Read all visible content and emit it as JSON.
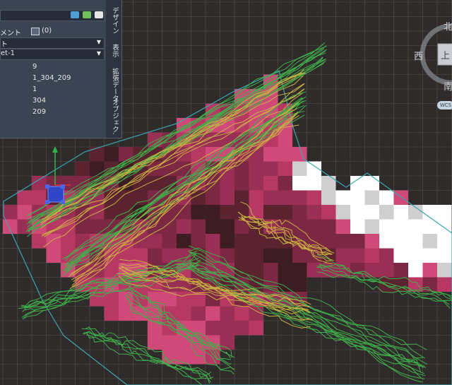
{
  "palette": {
    "comment_label": "メント",
    "comment_count": "(0)",
    "dropdown_1": "",
    "dropdown_2": "ト",
    "dropdown_3": "et-1",
    "values": [
      "9",
      "1_304_209",
      "1",
      "304",
      "209"
    ],
    "tabs": [
      "デザイン",
      "表示",
      "拡張データ",
      "オブジェク."
    ]
  },
  "viewcube": {
    "north": "北",
    "south": "南",
    "west": "西",
    "top_face": "上",
    "wcs_label": "WCS"
  },
  "colors": {
    "background": "#2f2b2b",
    "grid": "#4a4646",
    "boundary": "#3aa6b0",
    "contour_green": "#3fb04a",
    "contour_yellow": "#c9b042",
    "cell_palette": [
      "#3c1d23",
      "#5b2230",
      "#7c2844",
      "#9a2f55",
      "#b83864",
      "#cf4a78",
      "#e8e4e4",
      "#cfcfcf",
      "#ffffff"
    ]
  }
}
